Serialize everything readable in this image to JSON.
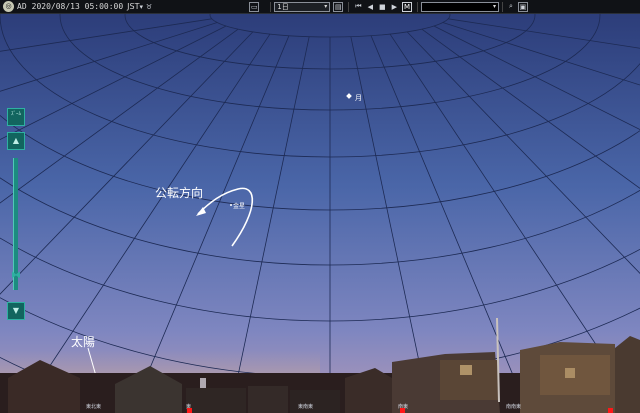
{
  "toolbar": {
    "era": "AD",
    "datetime": "2020/08/13 05:00:00",
    "timezone": "JST",
    "step_select": "1日",
    "play_buttons": [
      "⏮",
      "◀",
      "■",
      "▶"
    ],
    "mode_button": "M"
  },
  "side_panel": {
    "top_label": "ｽﾞｰﾑ",
    "up_icon": "▲",
    "down_icon": "▼"
  },
  "sky_labels": {
    "moon": "月",
    "venus": "金星",
    "direction": "公転方向",
    "sun": "太陽"
  },
  "directions": [
    {
      "label": "東北東",
      "pos": 0.135
    },
    {
      "label": "東",
      "pos": 0.29
    },
    {
      "label": "東南東",
      "pos": 0.465
    },
    {
      "label": "南東",
      "pos": 0.622
    },
    {
      "label": "南南東",
      "pos": 0.79
    }
  ],
  "colors": {
    "sky_top": "#2a3f78",
    "sky_bottom": "#9a93c8",
    "grid": "#1c2a50",
    "accent": "#1a7a70"
  }
}
